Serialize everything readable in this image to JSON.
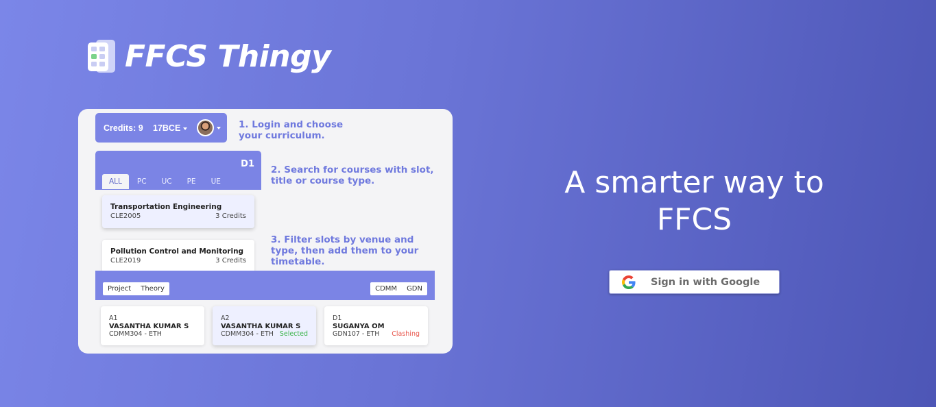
{
  "brand": {
    "name": "FFCS Thingy",
    "logo_icon": "grid-calendar-icon"
  },
  "preview": {
    "header": {
      "credits": "Credits: 9",
      "curriculum": "17BCE",
      "avatar_icon": "user-avatar"
    },
    "steps": {
      "step1": "1. Login and choose your curriculum.",
      "step2": "2. Search for courses with slot, title or course type.",
      "step3": "3. Filter slots by venue and type, then add them to your timetable."
    },
    "course_panel": {
      "slot": "D1",
      "filters": [
        "ALL",
        "PC",
        "UC",
        "PE",
        "UE"
      ],
      "courses": [
        {
          "title": "Transportation Engineering",
          "code": "CLE2005",
          "credits": "3 Credits"
        },
        {
          "title": "Pollution Control and Monitoring",
          "code": "CLE2019",
          "credits": "3 Credits"
        }
      ]
    },
    "slot_panel": {
      "type_filters": [
        "Project",
        "Theory"
      ],
      "venue_filters": [
        "CDMM",
        "GDN"
      ],
      "slots": [
        {
          "slot": "A1",
          "faculty": "VASANTHA KUMAR S",
          "venue": "CDMM304 - ETH",
          "status": ""
        },
        {
          "slot": "A2",
          "faculty": "VASANTHA KUMAR S",
          "venue": "CDMM304 - ETH",
          "status": "Selected"
        },
        {
          "slot": "D1",
          "faculty": "SUGANYA OM",
          "venue": "GDN107 - ETH",
          "status": "Clashing"
        }
      ]
    }
  },
  "hero": {
    "tagline": "A smarter way to FFCS",
    "signin_label": "Sign in with Google",
    "signin_icon": "google-g-icon"
  },
  "colors": {
    "accent": "#7b84e5",
    "selected": "#3cb44b",
    "clashing": "#e8554b"
  }
}
